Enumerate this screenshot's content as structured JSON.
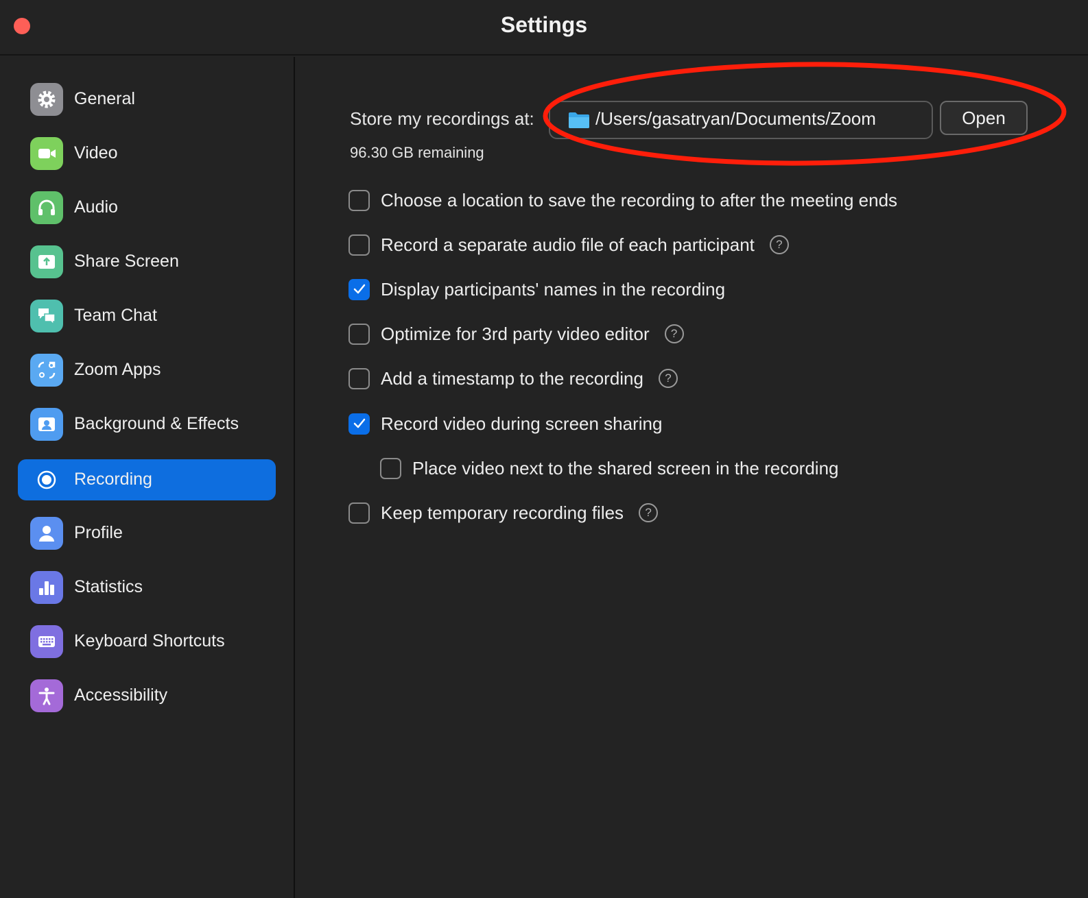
{
  "window": {
    "title": "Settings",
    "close_color": "#fe5f57"
  },
  "sidebar": {
    "active_color": "#0e6edf",
    "items": [
      {
        "label": "General",
        "icon": "gear-icon",
        "color": "#8e8e93",
        "active": false
      },
      {
        "label": "Video",
        "icon": "video-camera-icon",
        "color": "#7ed15c",
        "active": false
      },
      {
        "label": "Audio",
        "icon": "headphones-icon",
        "color": "#5fc06a",
        "active": false
      },
      {
        "label": "Share Screen",
        "icon": "share-screen-icon",
        "color": "#57c28f",
        "active": false
      },
      {
        "label": "Team Chat",
        "icon": "chat-bubbles-icon",
        "color": "#4fbfae",
        "active": false
      },
      {
        "label": "Zoom Apps",
        "icon": "apps-icon",
        "color": "#5aa9f2",
        "active": false
      },
      {
        "label": "Background & Effects",
        "icon": "background-person-icon",
        "color": "#4f9cf0",
        "active": false
      },
      {
        "label": "Recording",
        "icon": "record-icon",
        "color": "#0e6edf",
        "active": true
      },
      {
        "label": "Profile",
        "icon": "profile-person-icon",
        "color": "#5b8ff0",
        "active": false
      },
      {
        "label": "Statistics",
        "icon": "bar-chart-icon",
        "color": "#6a78e6",
        "active": false
      },
      {
        "label": "Keyboard Shortcuts",
        "icon": "keyboard-icon",
        "color": "#7f6fe0",
        "active": false
      },
      {
        "label": "Accessibility",
        "icon": "accessibility-icon",
        "color": "#a46ad8",
        "active": false
      }
    ]
  },
  "recording": {
    "store_label": "Store my recordings at:",
    "path": "/Users/gasatryan/Documents/Zoom",
    "open_label": "Open",
    "remaining": "96.30 GB remaining",
    "checkbox_color": "#0a6ee8",
    "annotation_color": "#ff1e0a",
    "options": [
      {
        "label": "Choose a location to save the recording to after the meeting ends",
        "checked": false,
        "help": false
      },
      {
        "label": "Record a separate audio file of each participant",
        "checked": false,
        "help": true
      },
      {
        "label": "Display participants' names in the recording",
        "checked": true,
        "help": false
      },
      {
        "label": "Optimize for 3rd party video editor",
        "checked": false,
        "help": true
      },
      {
        "label": "Add a timestamp to the recording",
        "checked": false,
        "help": true
      },
      {
        "label": "Record video during screen sharing",
        "checked": true,
        "help": false
      },
      {
        "label": "Place video next to the shared screen in the recording",
        "checked": false,
        "help": false,
        "indent": true
      },
      {
        "label": "Keep temporary recording files",
        "checked": false,
        "help": true
      }
    ],
    "help_glyph": "?"
  }
}
